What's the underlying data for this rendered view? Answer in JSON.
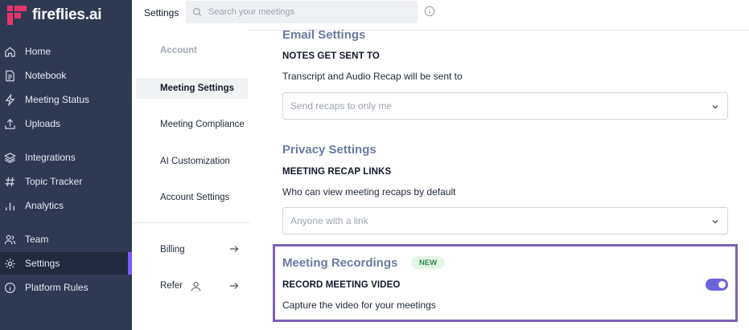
{
  "app": {
    "name": "fireflies.ai"
  },
  "sidebar": {
    "items": [
      {
        "label": "Home",
        "icon": "home-icon"
      },
      {
        "label": "Notebook",
        "icon": "notebook-icon"
      },
      {
        "label": "Meeting Status",
        "icon": "bolt-icon"
      },
      {
        "label": "Uploads",
        "icon": "upload-icon"
      },
      {
        "label": "Integrations",
        "icon": "layers-icon"
      },
      {
        "label": "Topic Tracker",
        "icon": "hash-icon"
      },
      {
        "label": "Analytics",
        "icon": "bar-chart-icon"
      },
      {
        "label": "Team",
        "icon": "team-icon"
      },
      {
        "label": "Settings",
        "icon": "gear-icon"
      },
      {
        "label": "Platform Rules",
        "icon": "info-icon"
      }
    ],
    "active": "Settings"
  },
  "topbar": {
    "title": "Settings",
    "search_placeholder": "Search your meetings"
  },
  "submenu": {
    "account": "Account",
    "meeting_settings": "Meeting Settings",
    "meeting_compliance": "Meeting Compliance",
    "ai_customization": "AI Customization",
    "account_settings": "Account Settings",
    "billing": "Billing",
    "refer": "Refer"
  },
  "main": {
    "email": {
      "title": "Email Settings",
      "label": "NOTES GET SENT TO",
      "desc": "Transcript and Audio Recap will be sent to",
      "select_value": "Send recaps to only me"
    },
    "privacy": {
      "title": "Privacy Settings",
      "label": "MEETING RECAP LINKS",
      "desc": "Who can view meeting recaps by default",
      "select_value": "Anyone with a link"
    },
    "recordings": {
      "title": "Meeting Recordings",
      "badge": "NEW",
      "label": "RECORD MEETING VIDEO",
      "desc": "Capture the video for your meetings",
      "toggle_on": true
    }
  },
  "colors": {
    "sidebar_bg": "#2f3a52",
    "accent": "#7c5cff",
    "section_title": "#6b7aa1",
    "highlight_border": "#7d5fb8",
    "toggle_on": "#6b63d9",
    "logo_pink": "#e8336d"
  }
}
